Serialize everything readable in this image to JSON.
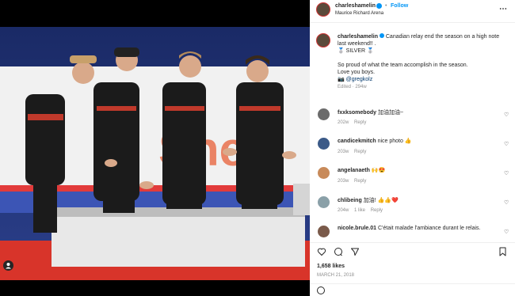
{
  "header": {
    "username": "charleshamelin",
    "follow_label": "Follow",
    "location": "Maurice Richard Arena",
    "dot": "•"
  },
  "caption": {
    "username": "charleshamelin",
    "line1": "Canadian relay end the season on a high note last weekend!! .",
    "line2": "🥈 SILVER 🥈",
    "line3": "So proud of what the team accomplish in the season.",
    "line4": "Love you boys.",
    "line5_prefix": "📷",
    "mention": "@gregkolz",
    "meta": "Edited · 294w"
  },
  "comments": [
    {
      "user": "fxxksomebody",
      "text": "加油加油~",
      "time": "202w",
      "reply": "Reply",
      "likes": ""
    },
    {
      "user": "candicekmitch",
      "text": "nice photo 👍",
      "time": "203w",
      "reply": "Reply",
      "likes": ""
    },
    {
      "user": "angelanaeth",
      "text": "🙌😍",
      "time": "203w",
      "reply": "Reply",
      "likes": ""
    },
    {
      "user": "chlibeing",
      "text": "加油! 👍👍❤️",
      "time": "204w",
      "reply": "Reply",
      "likes": "1 like"
    },
    {
      "user": "nicole.brule.01",
      "text": "C'était malade l'ambiance durant le relais.",
      "time": "",
      "reply": "",
      "likes": ""
    }
  ],
  "actions": {
    "likes": "1,658 likes",
    "date": "MARCH 21, 2018"
  },
  "colors": {
    "accent": "#0095f6",
    "podium": "#e8e8e8",
    "track": "#d8342a"
  }
}
